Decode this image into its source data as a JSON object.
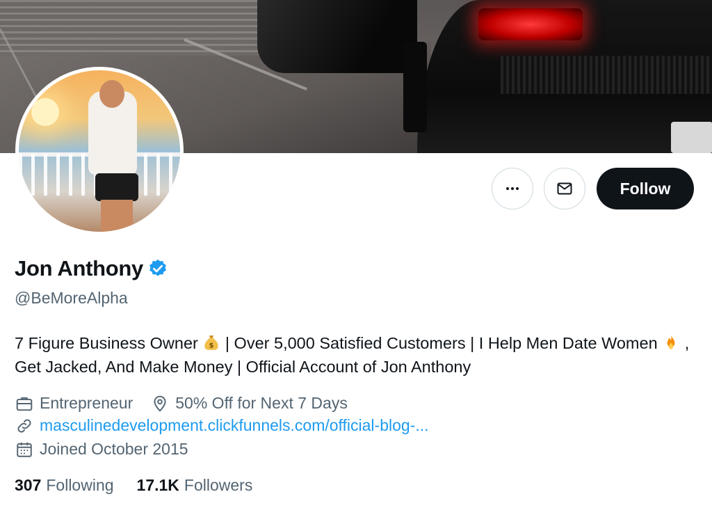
{
  "profile": {
    "name": "Jon Anthony",
    "handle": "@BeMoreAlpha",
    "bio_part1": "7 Figure Business Owner",
    "bio_part2": " | Over 5,000 Satisfied Customers | I Help Men Date Women",
    "bio_part3": ", Get Jacked, And Make Money | Official Account of Jon Anthony",
    "bio_emoji_1": "money-bag-emoji",
    "bio_emoji_2": "fire-emoji",
    "category": "Entrepreneur",
    "location": "50% Off for Next 7 Days",
    "website": "masculinedevelopment.clickfunnels.com/official-blog-...",
    "joined": "Joined October 2015"
  },
  "actions": {
    "more_icon": "more-horizontal-icon",
    "message_icon": "envelope-icon",
    "follow_label": "Follow"
  },
  "stats": {
    "following_count": "307",
    "following_label": "Following",
    "followers_count": "17.1K",
    "followers_label": "Followers"
  },
  "colors": {
    "accent": "#1d9bf0",
    "text": "#0f1419",
    "secondary_text": "#536471",
    "follow_bg": "#0f1419",
    "border": "#cfd9de"
  }
}
